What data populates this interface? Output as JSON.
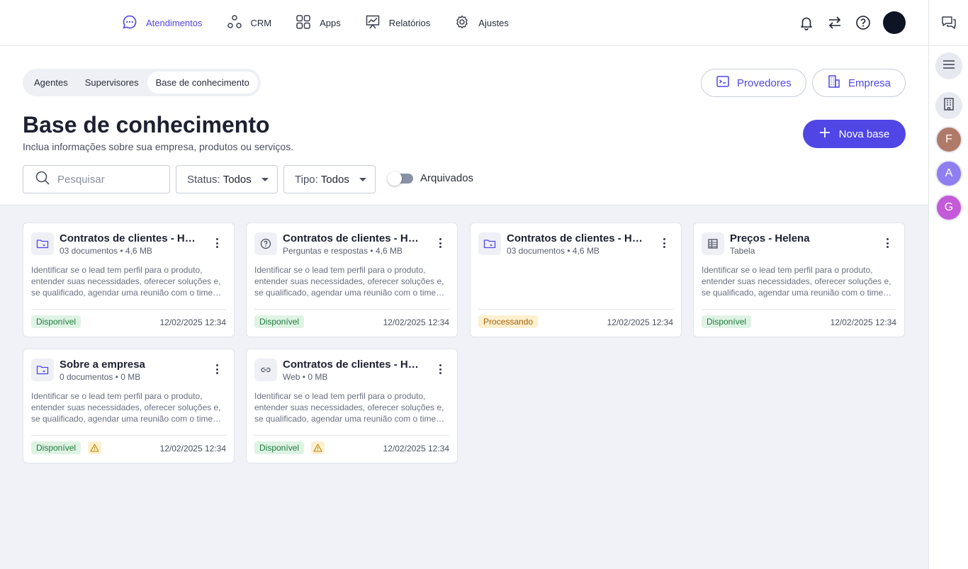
{
  "nav": {
    "items": [
      {
        "label": "Atendimentos",
        "icon": "chat-bubble-icon",
        "active": true
      },
      {
        "label": "CRM",
        "icon": "nodes-icon",
        "active": false
      },
      {
        "label": "Apps",
        "icon": "grid-icon",
        "active": false
      },
      {
        "label": "Relatórios",
        "icon": "chart-board-icon",
        "active": false
      },
      {
        "label": "Ajustes",
        "icon": "gear-icon",
        "active": false
      }
    ]
  },
  "tabs": {
    "agentes": "Agentes",
    "supervisores": "Supervisores",
    "base": "Base de conhecimento"
  },
  "header": {
    "providers_label": "Provedores",
    "company_label": "Empresa",
    "title": "Base de conhecimento",
    "subtitle": "Inclua informações sobre sua empresa, produtos ou serviços.",
    "new_base_label": "Nova base"
  },
  "filters": {
    "search_placeholder": "Pesquisar",
    "status_label": "Status:",
    "status_value": "Todos",
    "type_label": "Tipo:",
    "type_value": "Todos",
    "archived_label": "Arquivados",
    "archived_on": false
  },
  "rail": {
    "avatars": [
      {
        "initial": "F",
        "color": "#b07a68"
      },
      {
        "initial": "A",
        "color": "#8f7ef0"
      },
      {
        "initial": "G",
        "color": "#c45ad8"
      }
    ]
  },
  "cards": [
    {
      "icon": "folder-sparkle-icon",
      "title": "Contratos de clientes - Helena",
      "meta": "03 documentos • 4,6 MB",
      "desc": "Identificar se o lead tem perfil para o produto, entender suas necessidades, oferecer soluções e, se qualificado, agendar uma reunião com o time comercial.",
      "status": "Disponível",
      "status_type": "ok",
      "warning": false,
      "date": "12/02/2025 12:34"
    },
    {
      "icon": "question-circle-icon",
      "title": "Contratos de clientes - Helena",
      "meta": "Perguntas e respostas • 4,6 MB",
      "desc": "Identificar se o lead tem perfil para o produto, entender suas necessidades, oferecer soluções e, se qualificado, agendar uma reunião com o time comercial.",
      "status": "Disponível",
      "status_type": "ok",
      "warning": false,
      "date": "12/02/2025 12:34"
    },
    {
      "icon": "folder-sparkle-icon",
      "title": "Contratos de clientes - Helena",
      "meta": "03 documentos • 4,6 MB",
      "desc": "",
      "status": "Processando",
      "status_type": "proc",
      "warning": false,
      "date": "12/02/2025 12:34"
    },
    {
      "icon": "table-icon",
      "title": "Preços - Helena",
      "meta": "Tabela",
      "desc": "Identificar se o lead tem perfil para o produto, entender suas necessidades, oferecer soluções e, se qualificado, agendar uma reunião com o time comercial.",
      "status": "Disponível",
      "status_type": "ok",
      "warning": false,
      "date": "12/02/2025 12:34"
    },
    {
      "icon": "folder-sparkle-icon",
      "title": "Sobre a empresa",
      "meta": "0 documentos • 0 MB",
      "desc": "Identificar se o lead tem perfil para o produto, entender suas necessidades, oferecer soluções e, se qualificado, agendar uma reunião com o time comercial.",
      "status": "Disponível",
      "status_type": "ok",
      "warning": true,
      "date": "12/02/2025 12:34"
    },
    {
      "icon": "link-icon",
      "title": "Contratos de clientes - Helena",
      "meta": "Web • 0 MB",
      "desc": "Identificar se o lead tem perfil para o produto, entender suas necessidades, oferecer soluções e, se qualificado, agendar uma reunião com o time comercial.",
      "status": "Disponível",
      "status_type": "ok",
      "warning": true,
      "date": "12/02/2025 12:34"
    }
  ],
  "colors": {
    "accent": "#4f46e5",
    "success_bg": "#dff3e4",
    "warning_bg": "#fdf0cf"
  }
}
